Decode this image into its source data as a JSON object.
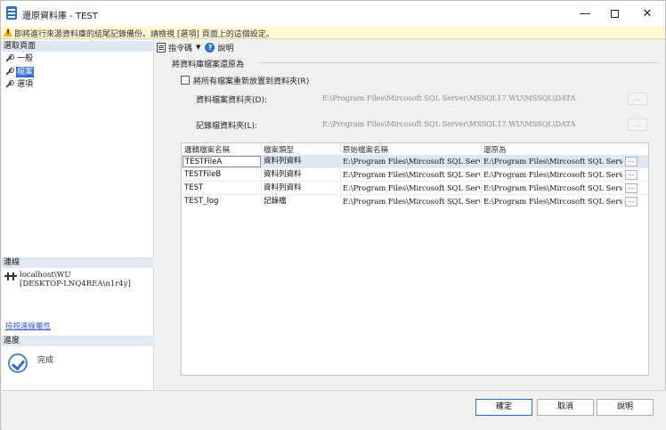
{
  "window": {
    "title": "還原資料庫 - TEST"
  },
  "window_controls": {
    "minimize": "—",
    "maximize": "",
    "close": "✕"
  },
  "warning": {
    "text": "即將進行來源資料庫的結尾記錄備份。請檢視 [選項] 頁面上的這個設定。"
  },
  "left_pane": {
    "select_page_header": "選取頁面",
    "pages": [
      {
        "label": "一般",
        "selected": false
      },
      {
        "label": "檔案",
        "selected": true
      },
      {
        "label": "選項",
        "selected": false
      }
    ],
    "connection_header": "連線",
    "connection_lines": [
      "localhost\\WU",
      "[DESKTOP-LNQ4REA\\n1r4y]"
    ],
    "view_connection_properties": "檢視連線屬性",
    "progress_header": "進度",
    "progress_status": "完成"
  },
  "toolbar": {
    "script_label": "指令碼",
    "dropdown_glyph": "▼",
    "help_label": "說明",
    "help_glyph": "?"
  },
  "restore_group": {
    "title": "將資料庫檔案還原為",
    "relocate_checkbox_label": "將所有檔案重新放置到資料夾(R)",
    "relocate_checked": false,
    "data_folder_label": "資料檔案資料夾(D):",
    "data_folder_value": "E:\\Program Files\\Mircosoft  SQL Server\\MSSQL17.WU\\MSSQL\\DATA",
    "log_folder_label": "記錄檔資料夾(L):",
    "log_folder_value": "E:\\Program Files\\Mircosoft  SQL Server\\MSSQL17.WU\\MSSQL\\DATA",
    "browse_label": "..."
  },
  "file_grid": {
    "columns": [
      "邏輯檔案名稱",
      "檔案類型",
      "原始檔案名稱",
      "還原為"
    ],
    "rows": [
      {
        "logical": "TESTFileA",
        "type": "資料列資料",
        "original": "E:\\Program Files\\Mircosoft  SQL Serv...",
        "restore_as": "E:\\Program Files\\Mircosoft  SQL Serv..."
      },
      {
        "logical": "TESTFileB",
        "type": "資料列資料",
        "original": "E:\\Program Files\\Mircosoft  SQL Serv...",
        "restore_as": "E:\\Program Files\\Mircosoft  SQL Serv..."
      },
      {
        "logical": "TEST",
        "type": "資料列資料",
        "original": "E:\\Program Files\\Mircosoft  SQL Serv...",
        "restore_as": "E:\\Program Files\\Mircosoft  SQL Serv..."
      },
      {
        "logical": "TEST_log",
        "type": "記錄檔",
        "original": "E:\\Program Files\\Mircosoft  SQL Serv...",
        "restore_as": "E:\\Program Files\\Mircosoft  SQL Serv..."
      }
    ],
    "ellipsis_label": "..."
  },
  "footer": {
    "ok_label": "確定",
    "cancel_label": "取消",
    "help_label": "說明"
  }
}
